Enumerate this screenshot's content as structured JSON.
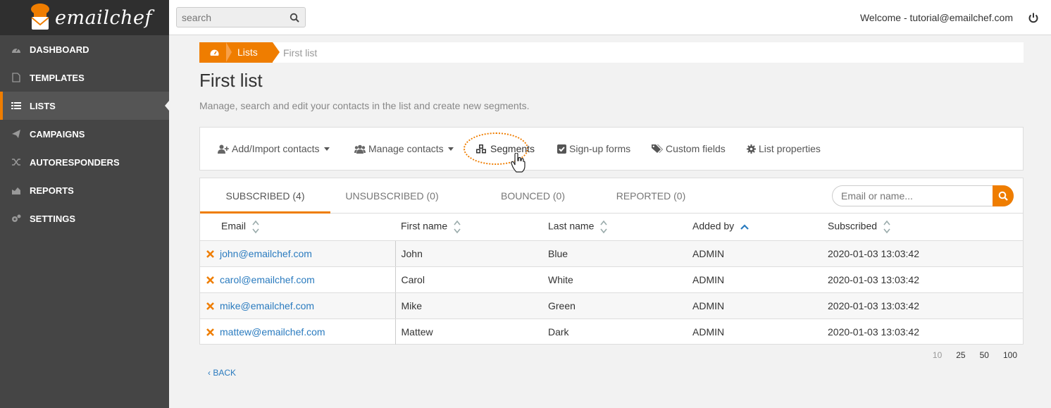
{
  "brand": {
    "name": "emailchef"
  },
  "sidebar": {
    "items": [
      {
        "label": "DASHBOARD",
        "icon": "dashboard-icon"
      },
      {
        "label": "TEMPLATES",
        "icon": "file-icon"
      },
      {
        "label": "LISTS",
        "icon": "list-icon",
        "active": true
      },
      {
        "label": "CAMPAIGNS",
        "icon": "paper-plane-icon"
      },
      {
        "label": "AUTORESPONDERS",
        "icon": "random-icon"
      },
      {
        "label": "REPORTS",
        "icon": "area-chart-icon"
      },
      {
        "label": "SETTINGS",
        "icon": "cogs-icon"
      }
    ]
  },
  "topbar": {
    "search_placeholder": "search",
    "welcome": "Welcome - tutorial@emailchef.com"
  },
  "breadcrumb": {
    "section": "Lists",
    "current": "First list"
  },
  "page": {
    "title": "First list",
    "description": "Manage, search and edit your contacts in the list and create new segments."
  },
  "toolbar": {
    "add_import": "Add/Import contacts",
    "manage": "Manage contacts",
    "segments": "Segments",
    "signup_forms": "Sign-up forms",
    "custom_fields": "Custom fields",
    "list_properties": "List properties"
  },
  "tabs": {
    "subscribed": "SUBSCRIBED (4)",
    "unsubscribed": "UNSUBSCRIBED (0)",
    "bounced": "BOUNCED (0)",
    "reported": "REPORTED (0)"
  },
  "filter_placeholder": "Email or name...",
  "table": {
    "columns": [
      "Email",
      "First name",
      "Last name",
      "Added by",
      "Subscribed"
    ],
    "rows": [
      {
        "email": "john@emailchef.com",
        "first": "John",
        "last": "Blue",
        "added_by": "ADMIN",
        "subscribed": "2020-01-03 13:03:42"
      },
      {
        "email": "carol@emailchef.com",
        "first": "Carol",
        "last": "White",
        "added_by": "ADMIN",
        "subscribed": "2020-01-03 13:03:42"
      },
      {
        "email": "mike@emailchef.com",
        "first": "Mike",
        "last": "Green",
        "added_by": "ADMIN",
        "subscribed": "2020-01-03 13:03:42"
      },
      {
        "email": "mattew@emailchef.com",
        "first": "Mattew",
        "last": "Dark",
        "added_by": "ADMIN",
        "subscribed": "2020-01-03 13:03:42"
      }
    ]
  },
  "pagination": {
    "options": [
      "10",
      "25",
      "50",
      "100"
    ],
    "selected": "10"
  },
  "back": "BACK",
  "colors": {
    "accent": "#ef7d00",
    "sidebar": "#454545",
    "link": "#2a7bbf"
  }
}
